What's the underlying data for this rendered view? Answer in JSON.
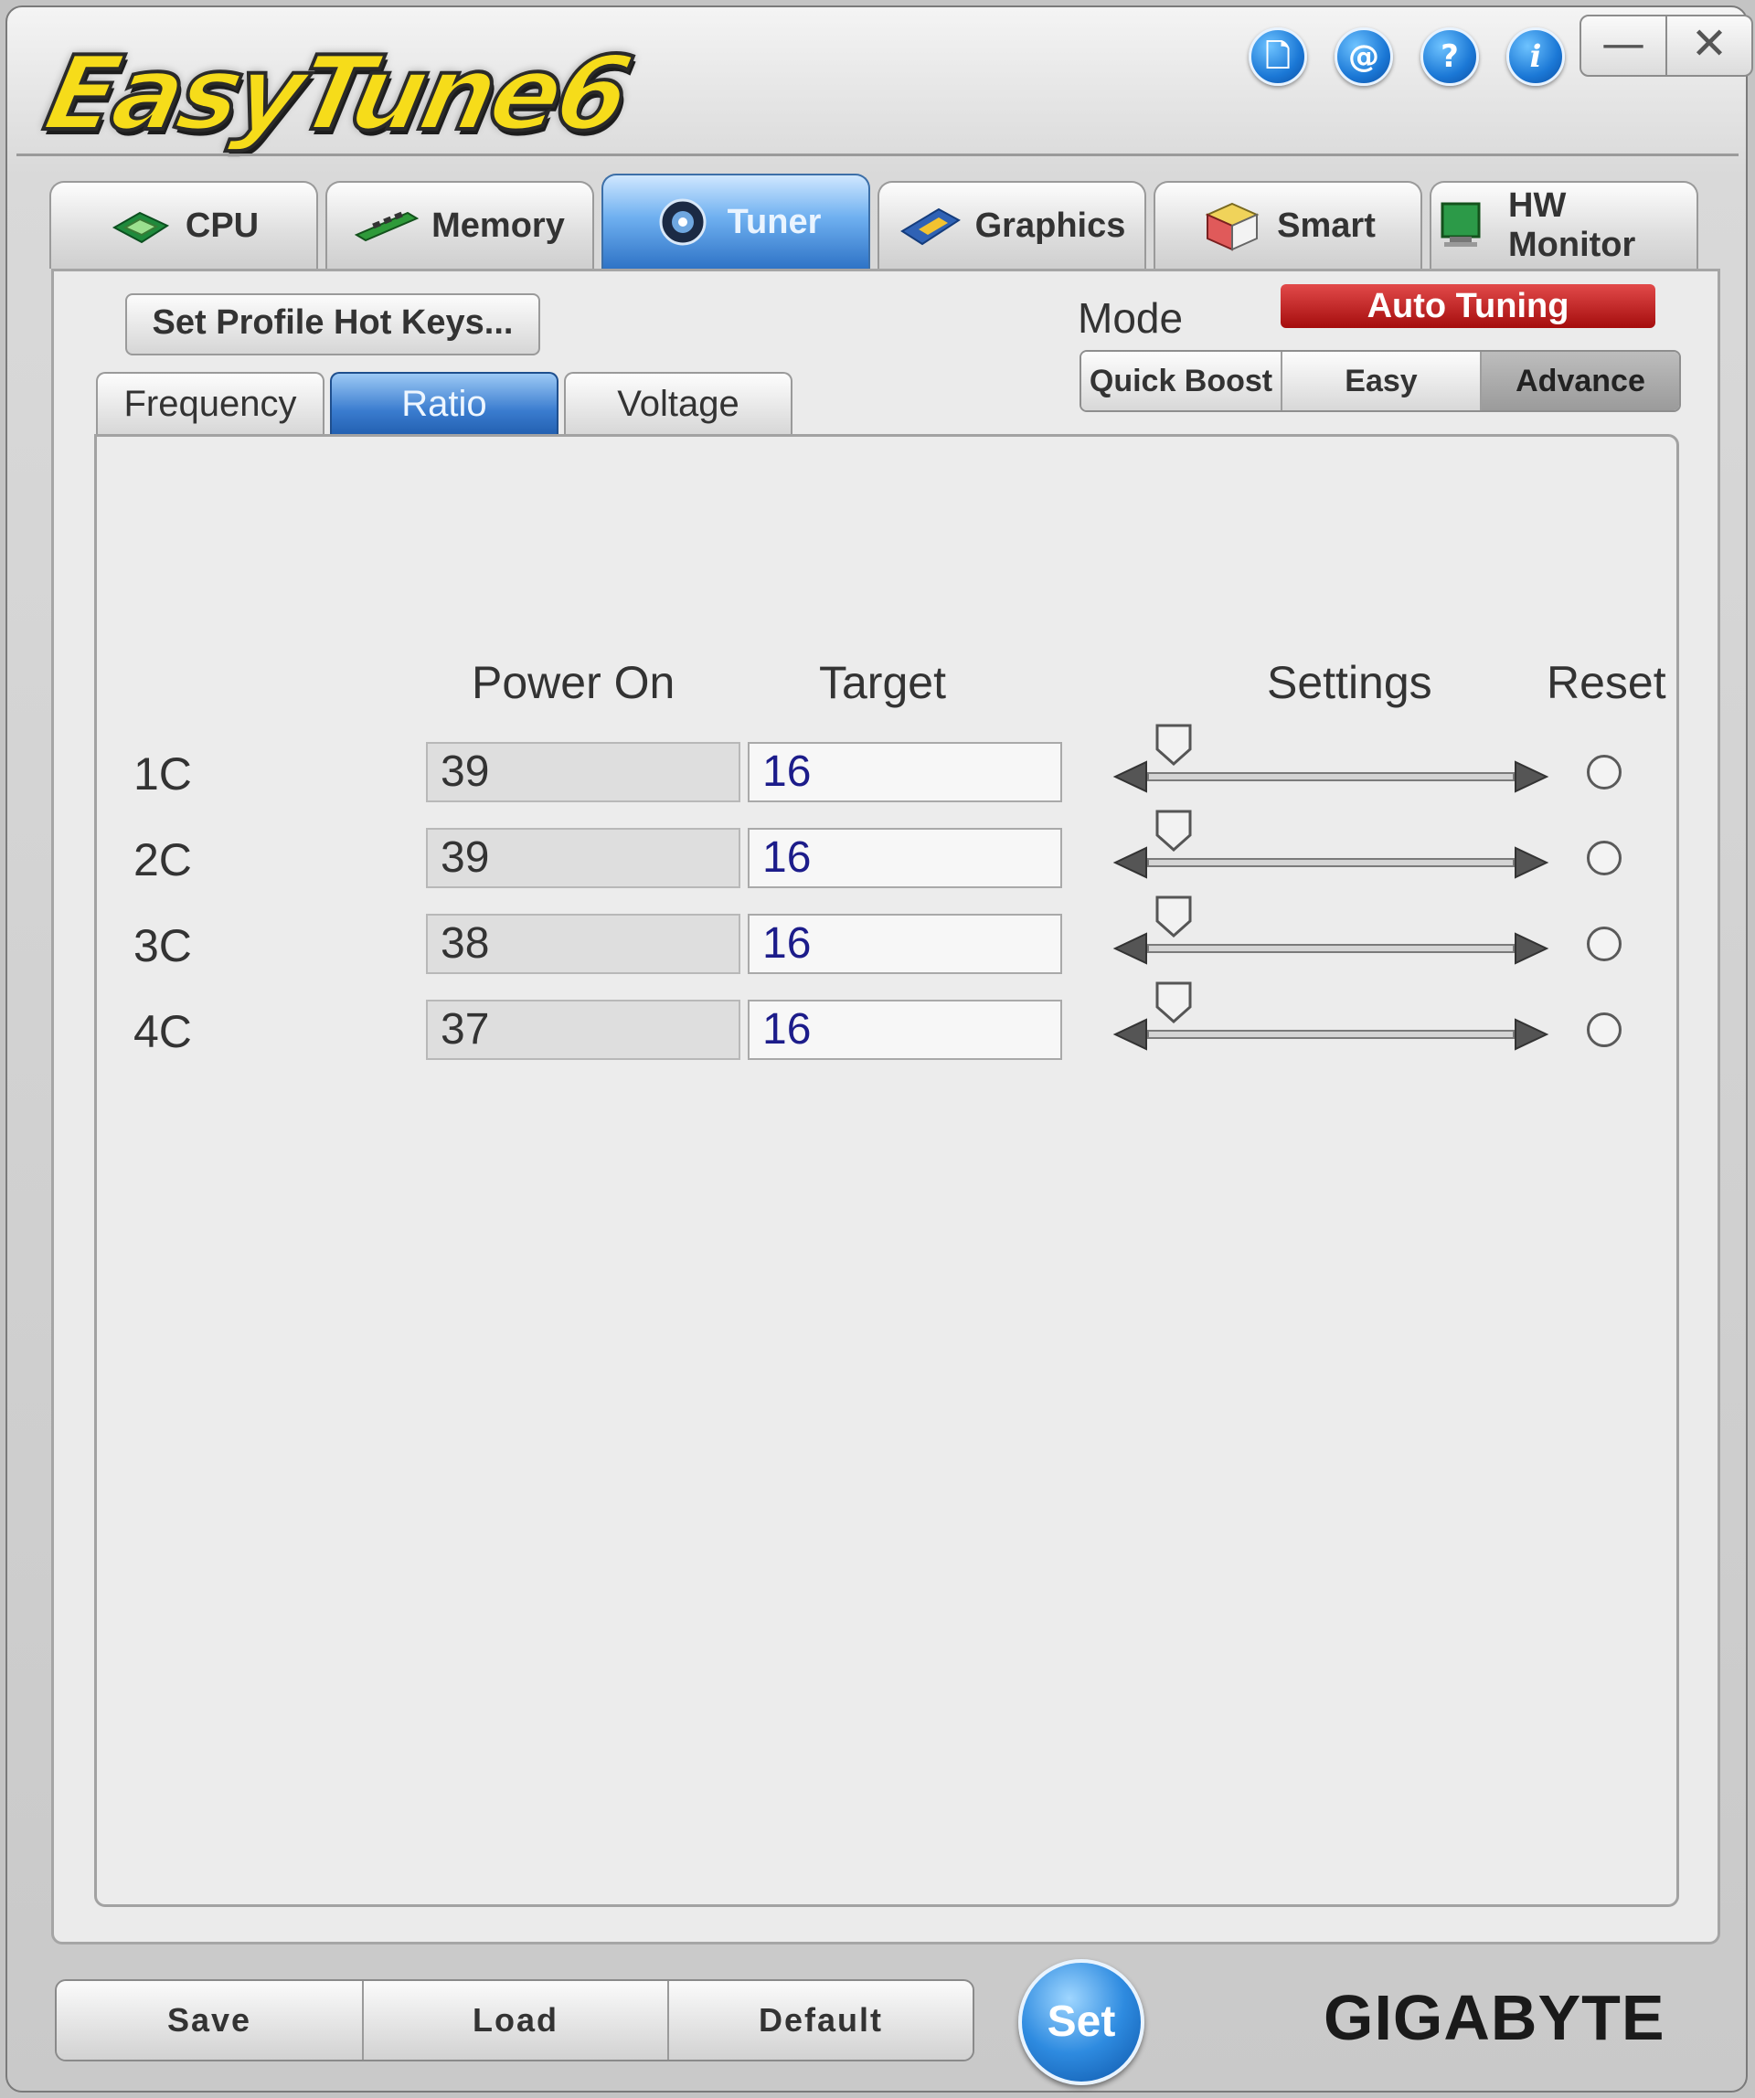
{
  "app": {
    "logo_text": "EasyTune6"
  },
  "header_icons": [
    {
      "name": "document-icon",
      "glyph": "🗋"
    },
    {
      "name": "at-sign-icon",
      "glyph": "@"
    },
    {
      "name": "help-icon",
      "glyph": "?"
    },
    {
      "name": "info-icon",
      "glyph": "i"
    }
  ],
  "window_controls": {
    "minimize": "—",
    "close": "✕"
  },
  "main_tabs": [
    {
      "label": "CPU",
      "icon": "cpu-chip-icon"
    },
    {
      "label": "Memory",
      "icon": "memory-module-icon"
    },
    {
      "label": "Tuner",
      "icon": "tuner-icon",
      "active": true
    },
    {
      "label": "Graphics",
      "icon": "graphics-card-icon"
    },
    {
      "label": "Smart",
      "icon": "cube-icon"
    },
    {
      "label": "HW Monitor",
      "icon": "monitor-icon"
    }
  ],
  "toolbar": {
    "hotkeys_label": "Set Profile Hot Keys..."
  },
  "mode": {
    "label": "Mode",
    "auto_tuning_label": "Auto Tuning",
    "options": [
      "Quick Boost",
      "Easy",
      "Advance"
    ],
    "selected": "Advance"
  },
  "sub_tabs": [
    "Frequency",
    "Ratio",
    "Voltage"
  ],
  "active_sub_tab": "Ratio",
  "grid": {
    "headers": {
      "power_on": "Power On",
      "target": "Target",
      "settings": "Settings",
      "reset": "Reset"
    },
    "rows": [
      {
        "label": "1C",
        "power_on": "39",
        "target": "16",
        "slider_position": 0.07
      },
      {
        "label": "2C",
        "power_on": "39",
        "target": "16",
        "slider_position": 0.07
      },
      {
        "label": "3C",
        "power_on": "38",
        "target": "16",
        "slider_position": 0.07
      },
      {
        "label": "4C",
        "power_on": "37",
        "target": "16",
        "slider_position": 0.07
      }
    ]
  },
  "footer": {
    "buttons": [
      "Save",
      "Load",
      "Default"
    ],
    "set_label": "Set",
    "brand": "GIGABYTE"
  },
  "colors": {
    "accent_blue": "#2e73c6",
    "auto_tuning_red": "#c41e1e",
    "logo_yellow": "#f6dc1a"
  }
}
